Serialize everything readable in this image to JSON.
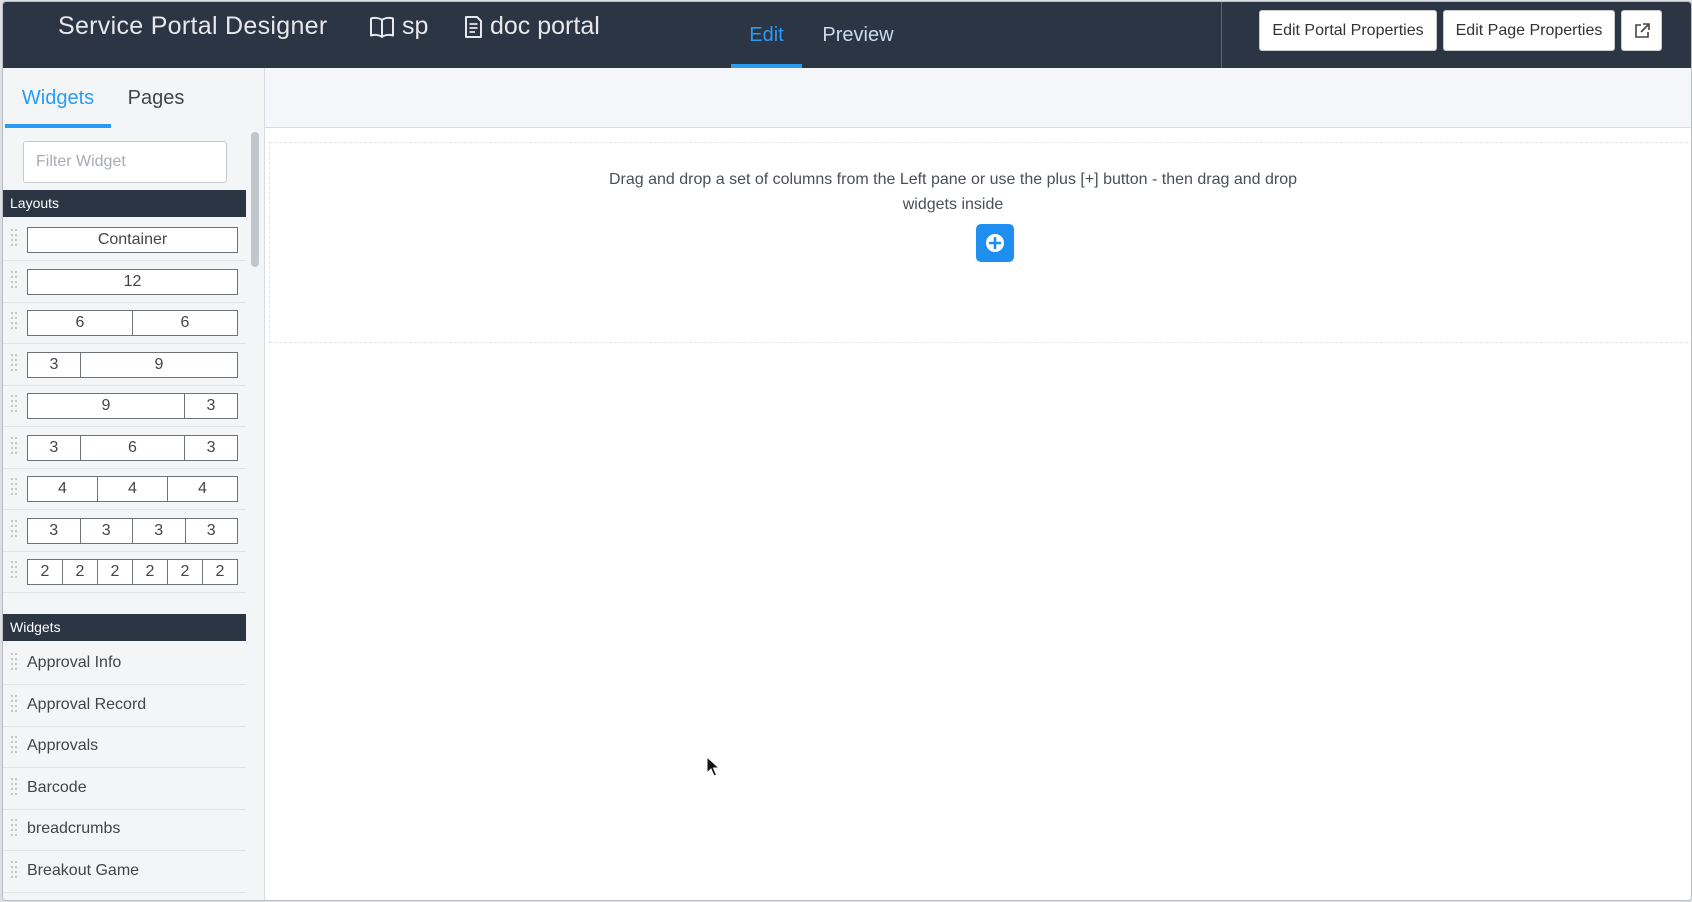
{
  "header": {
    "title": "Service Portal Designer",
    "portal_crumb": "sp",
    "page_crumb": "doc portal",
    "modes": [
      {
        "label": "Edit",
        "active": true
      },
      {
        "label": "Preview",
        "active": false
      }
    ],
    "edit_portal_label": "Edit Portal Properties",
    "edit_page_label": "Edit Page Properties",
    "external_icon": "external-link-icon",
    "accent_color": "#2a9cf5",
    "bar_color": "#2b3544"
  },
  "sidebar": {
    "tabs": [
      {
        "label": "Widgets",
        "active": true
      },
      {
        "label": "Pages",
        "active": false
      }
    ],
    "filter_placeholder": "Filter Widget",
    "layouts_header": "Layouts",
    "layouts": [
      {
        "cells": [
          "Container"
        ]
      },
      {
        "cells": [
          "12"
        ]
      },
      {
        "cells": [
          "6",
          "6"
        ]
      },
      {
        "cells": [
          "3",
          "9"
        ]
      },
      {
        "cells": [
          "9",
          "3"
        ]
      },
      {
        "cells": [
          "3",
          "6",
          "3"
        ]
      },
      {
        "cells": [
          "4",
          "4",
          "4"
        ]
      },
      {
        "cells": [
          "3",
          "3",
          "3",
          "3"
        ]
      },
      {
        "cells": [
          "2",
          "2",
          "2",
          "2",
          "2",
          "2"
        ]
      }
    ],
    "widgets_header": "Widgets",
    "widgets": [
      {
        "label": "Approval Info"
      },
      {
        "label": "Approval Record"
      },
      {
        "label": "Approvals"
      },
      {
        "label": "Barcode"
      },
      {
        "label": "breadcrumbs"
      },
      {
        "label": "Breakout Game"
      }
    ]
  },
  "canvas": {
    "drop_message": "Drag and drop a set of columns from the Left pane or use the plus [+] button - then drag and drop widgets inside",
    "add_icon": "plus-circle-icon"
  }
}
